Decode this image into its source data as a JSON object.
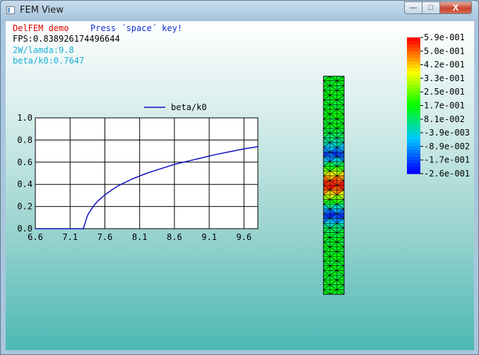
{
  "window": {
    "title": "FEM View",
    "min_icon": "minimize-icon",
    "max_icon": "maximize-icon",
    "close_icon": "close-icon",
    "min_label": "—",
    "max_label": "□",
    "close_label": "X"
  },
  "hud": {
    "demo": "DelFEM demo",
    "hint": "Press ´space´ key!",
    "fps": "FPS:0.838926174496644",
    "param": "2W/lamda:9.8",
    "beta": "beta/k0:0.7647",
    "colors": {
      "demo": "#e00000",
      "hint": "#1030d0",
      "fps": "#000000",
      "info": "#18b0d8"
    }
  },
  "chart_data": {
    "type": "line",
    "xlim": [
      6.6,
      9.8
    ],
    "ylim": [
      0.0,
      1.0
    ],
    "xticks": [
      "6.6",
      "7.1",
      "7.6",
      "8.1",
      "8.6",
      "9.1",
      "9.6"
    ],
    "yticks": [
      "0.0",
      "0.2",
      "0.4",
      "0.6",
      "0.8",
      "1.0"
    ],
    "grid": true,
    "legend": "top-center",
    "series": [
      {
        "name": "beta/k0",
        "color": "#1010c0",
        "x": [
          6.6,
          7.29,
          7.32,
          7.34,
          7.36,
          7.4,
          7.45,
          7.5,
          7.6,
          7.7,
          7.8,
          8.0,
          8.2,
          8.4,
          8.6,
          8.8,
          9.0,
          9.2,
          9.4,
          9.6,
          9.8
        ],
        "y": [
          0.0,
          0.0,
          0.06,
          0.1,
          0.13,
          0.17,
          0.215,
          0.25,
          0.305,
          0.35,
          0.39,
          0.45,
          0.5,
          0.54,
          0.58,
          0.61,
          0.64,
          0.67,
          0.695,
          0.72,
          0.74
        ]
      }
    ]
  },
  "colorbar": {
    "labels": [
      "5.9e-001",
      "5.0e-001",
      "4.2e-001",
      "3.3e-001",
      "2.5e-001",
      "1.7e-001",
      "8.1e-002",
      "-3.9e-003",
      "-8.9e-002",
      "-1.7e-001",
      "-2.6e-001"
    ]
  },
  "mesh": {
    "field": [
      0.14,
      0.15,
      0.13,
      0.16,
      0.15,
      0.14,
      0.13,
      0.15,
      0.17,
      0.13,
      0.16,
      0.12,
      0.1,
      0.06,
      0.01,
      -0.07,
      -0.2,
      -0.12,
      0.05,
      0.18,
      0.32,
      0.45,
      0.55,
      0.57,
      0.48,
      0.33,
      0.2,
      0.06,
      -0.09,
      -0.22,
      -0.12,
      0.02,
      0.09,
      0.12,
      0.14,
      0.13,
      0.15,
      0.14,
      0.16,
      0.13,
      0.15,
      0.14,
      0.13,
      0.15,
      0.14,
      0.15
    ]
  }
}
